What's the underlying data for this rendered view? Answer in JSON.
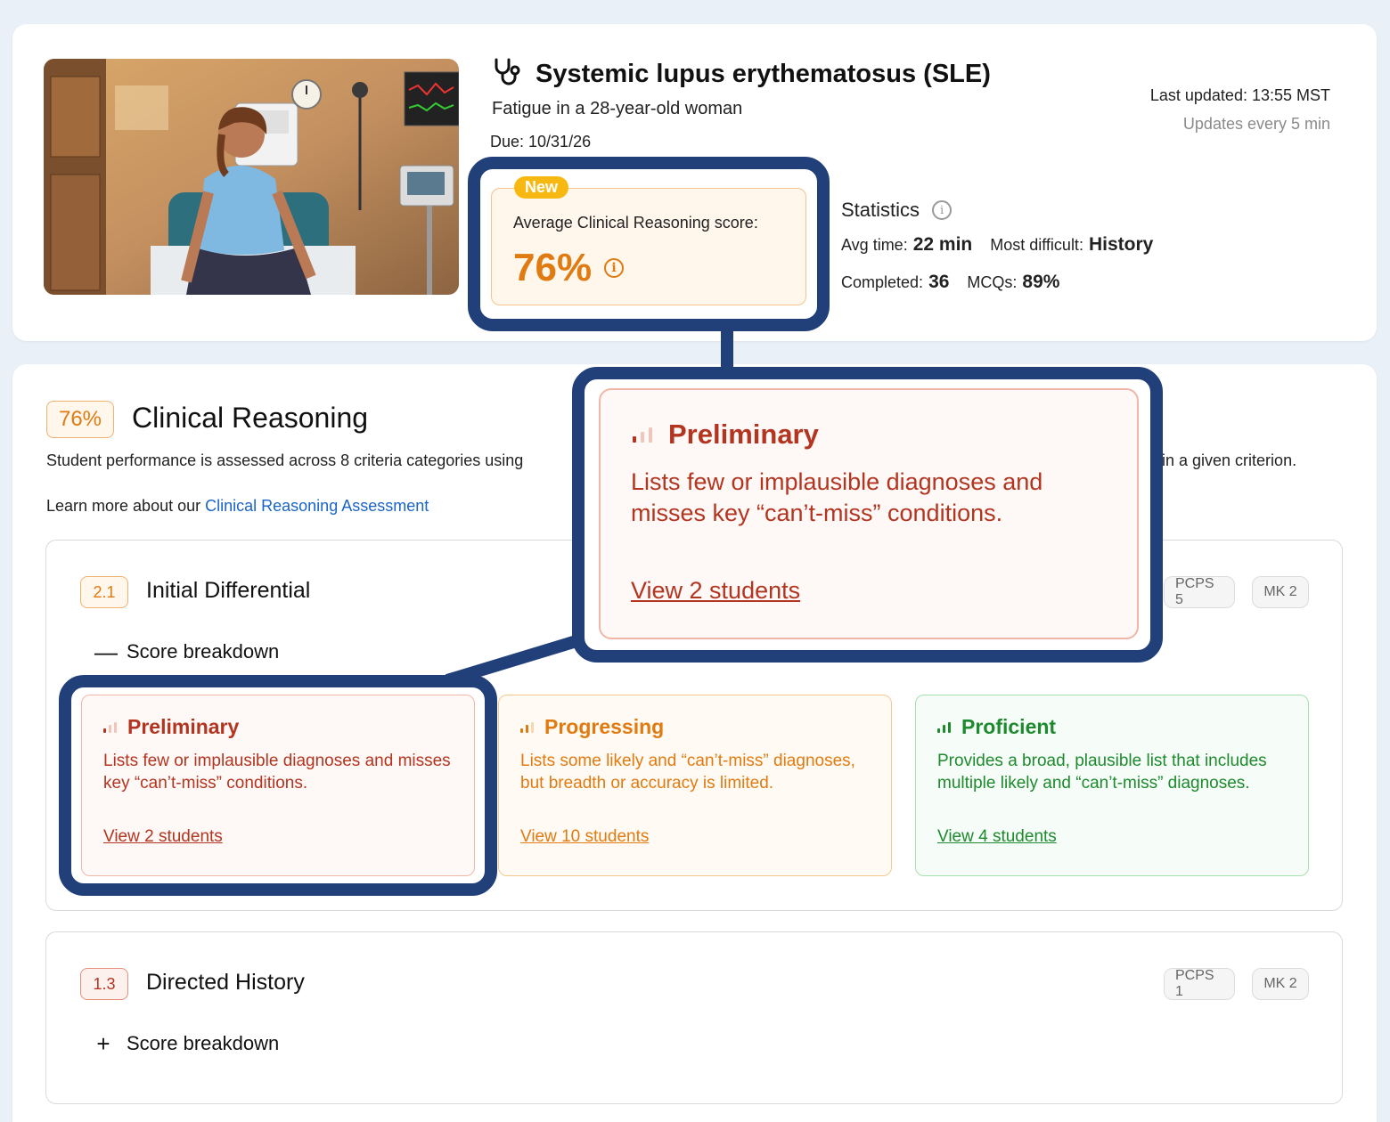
{
  "case": {
    "title": "Systemic lupus erythematosus (SLE)",
    "subtitle": "Fatigue in a 28-year-old woman",
    "due": "Due: 10/31/26",
    "last_updated": "Last updated: 13:55 MST",
    "update_freq": "Updates every 5 min"
  },
  "avg_score": {
    "badge": "New",
    "label": "Average Clinical Reasoning score:",
    "value": "76%"
  },
  "statistics": {
    "title": "Statistics",
    "avg_time_label": "Avg time:",
    "avg_time": "22 min",
    "most_difficult_label": "Most difficult:",
    "most_difficult": "History",
    "completed_label": "Completed:",
    "completed": "36",
    "mcqs_label": "MCQs:",
    "mcqs": "89%"
  },
  "clinical_reasoning": {
    "pct": "76%",
    "title": "Clinical Reasoning",
    "desc_start": "Student performance is assessed across 8 criteria categories using",
    "desc_end": "in a given criterion.",
    "learn_prefix": "Learn more about our",
    "learn_link": "Clinical Reasoning Assessment"
  },
  "criteria": [
    {
      "num": "2.1",
      "title": "Initial Differential",
      "chips": [
        "PCPS 5",
        "MK 2"
      ],
      "breakdown_label": "Score breakdown",
      "toggle": "—",
      "levels": [
        {
          "name": "Preliminary",
          "desc": "Lists few or implausible diagnoses and misses key “can’t-miss” conditions.",
          "link": "View 2 students"
        },
        {
          "name": "Progressing",
          "desc": "Lists some likely and “can’t-miss” diagnoses, but breadth or accuracy is limited.",
          "link": "View 10 students"
        },
        {
          "name": "Proficient",
          "desc": "Provides a broad, plausible list that includes multiple likely and “can’t-miss” diagnoses.",
          "link": "View 4 students"
        }
      ]
    },
    {
      "num": "1.3",
      "title": "Directed History",
      "chips": [
        "PCPS 1",
        "MK 2"
      ],
      "breakdown_label": "Score breakdown",
      "toggle": "+"
    }
  ],
  "zoom": {
    "name": "Preliminary",
    "desc": "Lists few or implausible diagnoses and misses key “can’t-miss” conditions.",
    "link": "View 2 students"
  },
  "colors": {
    "accent_orange": "#e07b12",
    "preliminary_red": "#b33520",
    "proficient_green": "#1e8a2e",
    "highlight_navy": "#213f79",
    "link_blue": "#1a64c8"
  }
}
